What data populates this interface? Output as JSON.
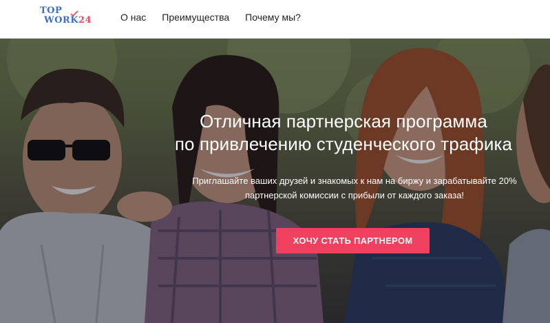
{
  "colors": {
    "logo_primary": "#3d6fc4",
    "logo_accent": "#e8465f",
    "cta_background": "#f0405f",
    "nav_text": "#222222",
    "hero_text": "#ffffff"
  },
  "header": {
    "logo": {
      "line1": "TOP",
      "line2_text": "WORK",
      "line2_number": "24"
    },
    "nav": [
      {
        "label": "О нас"
      },
      {
        "label": "Преимущества"
      },
      {
        "label": "Почему мы?"
      }
    ]
  },
  "hero": {
    "title_line1": "Отличная партнерская программа",
    "title_line2": "по привлечению студенческого трафика",
    "subtitle_line1": "Приглашайте ваших друзей и знакомых к нам на биржу и зарабатывайте 20%",
    "subtitle_line2": "партнерской комиссии с прибыли от каждого заказа!",
    "cta_label": "ХОЧУ СТАТЬ ПАРТНЕРОМ",
    "background_image": "photo-of-smiling-students"
  }
}
